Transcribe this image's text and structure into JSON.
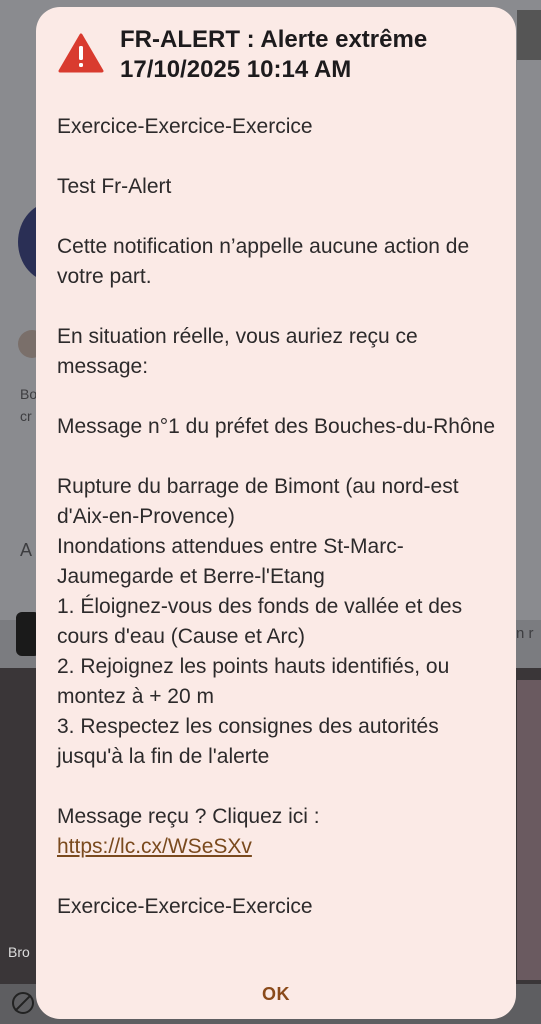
{
  "alert": {
    "title": "FR-ALERT : Alerte extrême",
    "datetime": "17/10/2025 10:14 AM",
    "paragraphs": [
      "Exercice-Exercice-Exercice",
      "Test Fr-Alert",
      "Cette notification n’appelle aucune action de votre part.",
      "En situation réelle, vous auriez reçu ce message:",
      "Message n°1 du préfet des Bouches-du-Rhône",
      "Rupture du barrage de Bimont (au nord-est d'Aix-en-Provence)\nInondations attendues entre St-Marc-Jaumegarde et Berre-l'Etang\n1. Éloignez-vous des fonds de vallée et des cours d'eau (Cause et Arc)\n2. Rejoignez les points hauts identifiés, ou montez à + 20 m\n3. Respectez les consignes des autorités jusqu'à la fin de l'alerte"
    ],
    "link_prompt": "Message reçu ? Cliquez ici :",
    "link_url": "https://lc.cx/WSeSXv",
    "footer_text": "Exercice-Exercice-Exercice",
    "ok_label": "OK",
    "icon": "warning-triangle-icon",
    "icon_color": "#d93b2f"
  },
  "background": {
    "fragments": [
      "Bo",
      "cr",
      "A",
      "n r",
      "Bro"
    ]
  }
}
